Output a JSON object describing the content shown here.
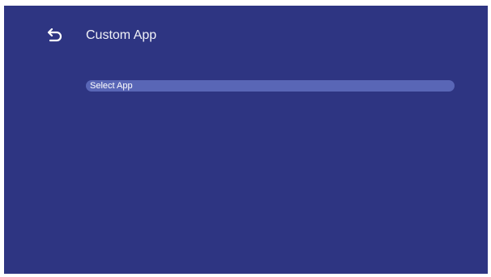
{
  "header": {
    "back_icon": "back-arrow-icon",
    "title": "Custom App"
  },
  "settings": {
    "items": [
      {
        "label": "Select App",
        "focused": true
      }
    ]
  },
  "colors": {
    "background": "#2e3582",
    "focus_highlight": "#5966b6",
    "text": "#f1f2f8"
  }
}
